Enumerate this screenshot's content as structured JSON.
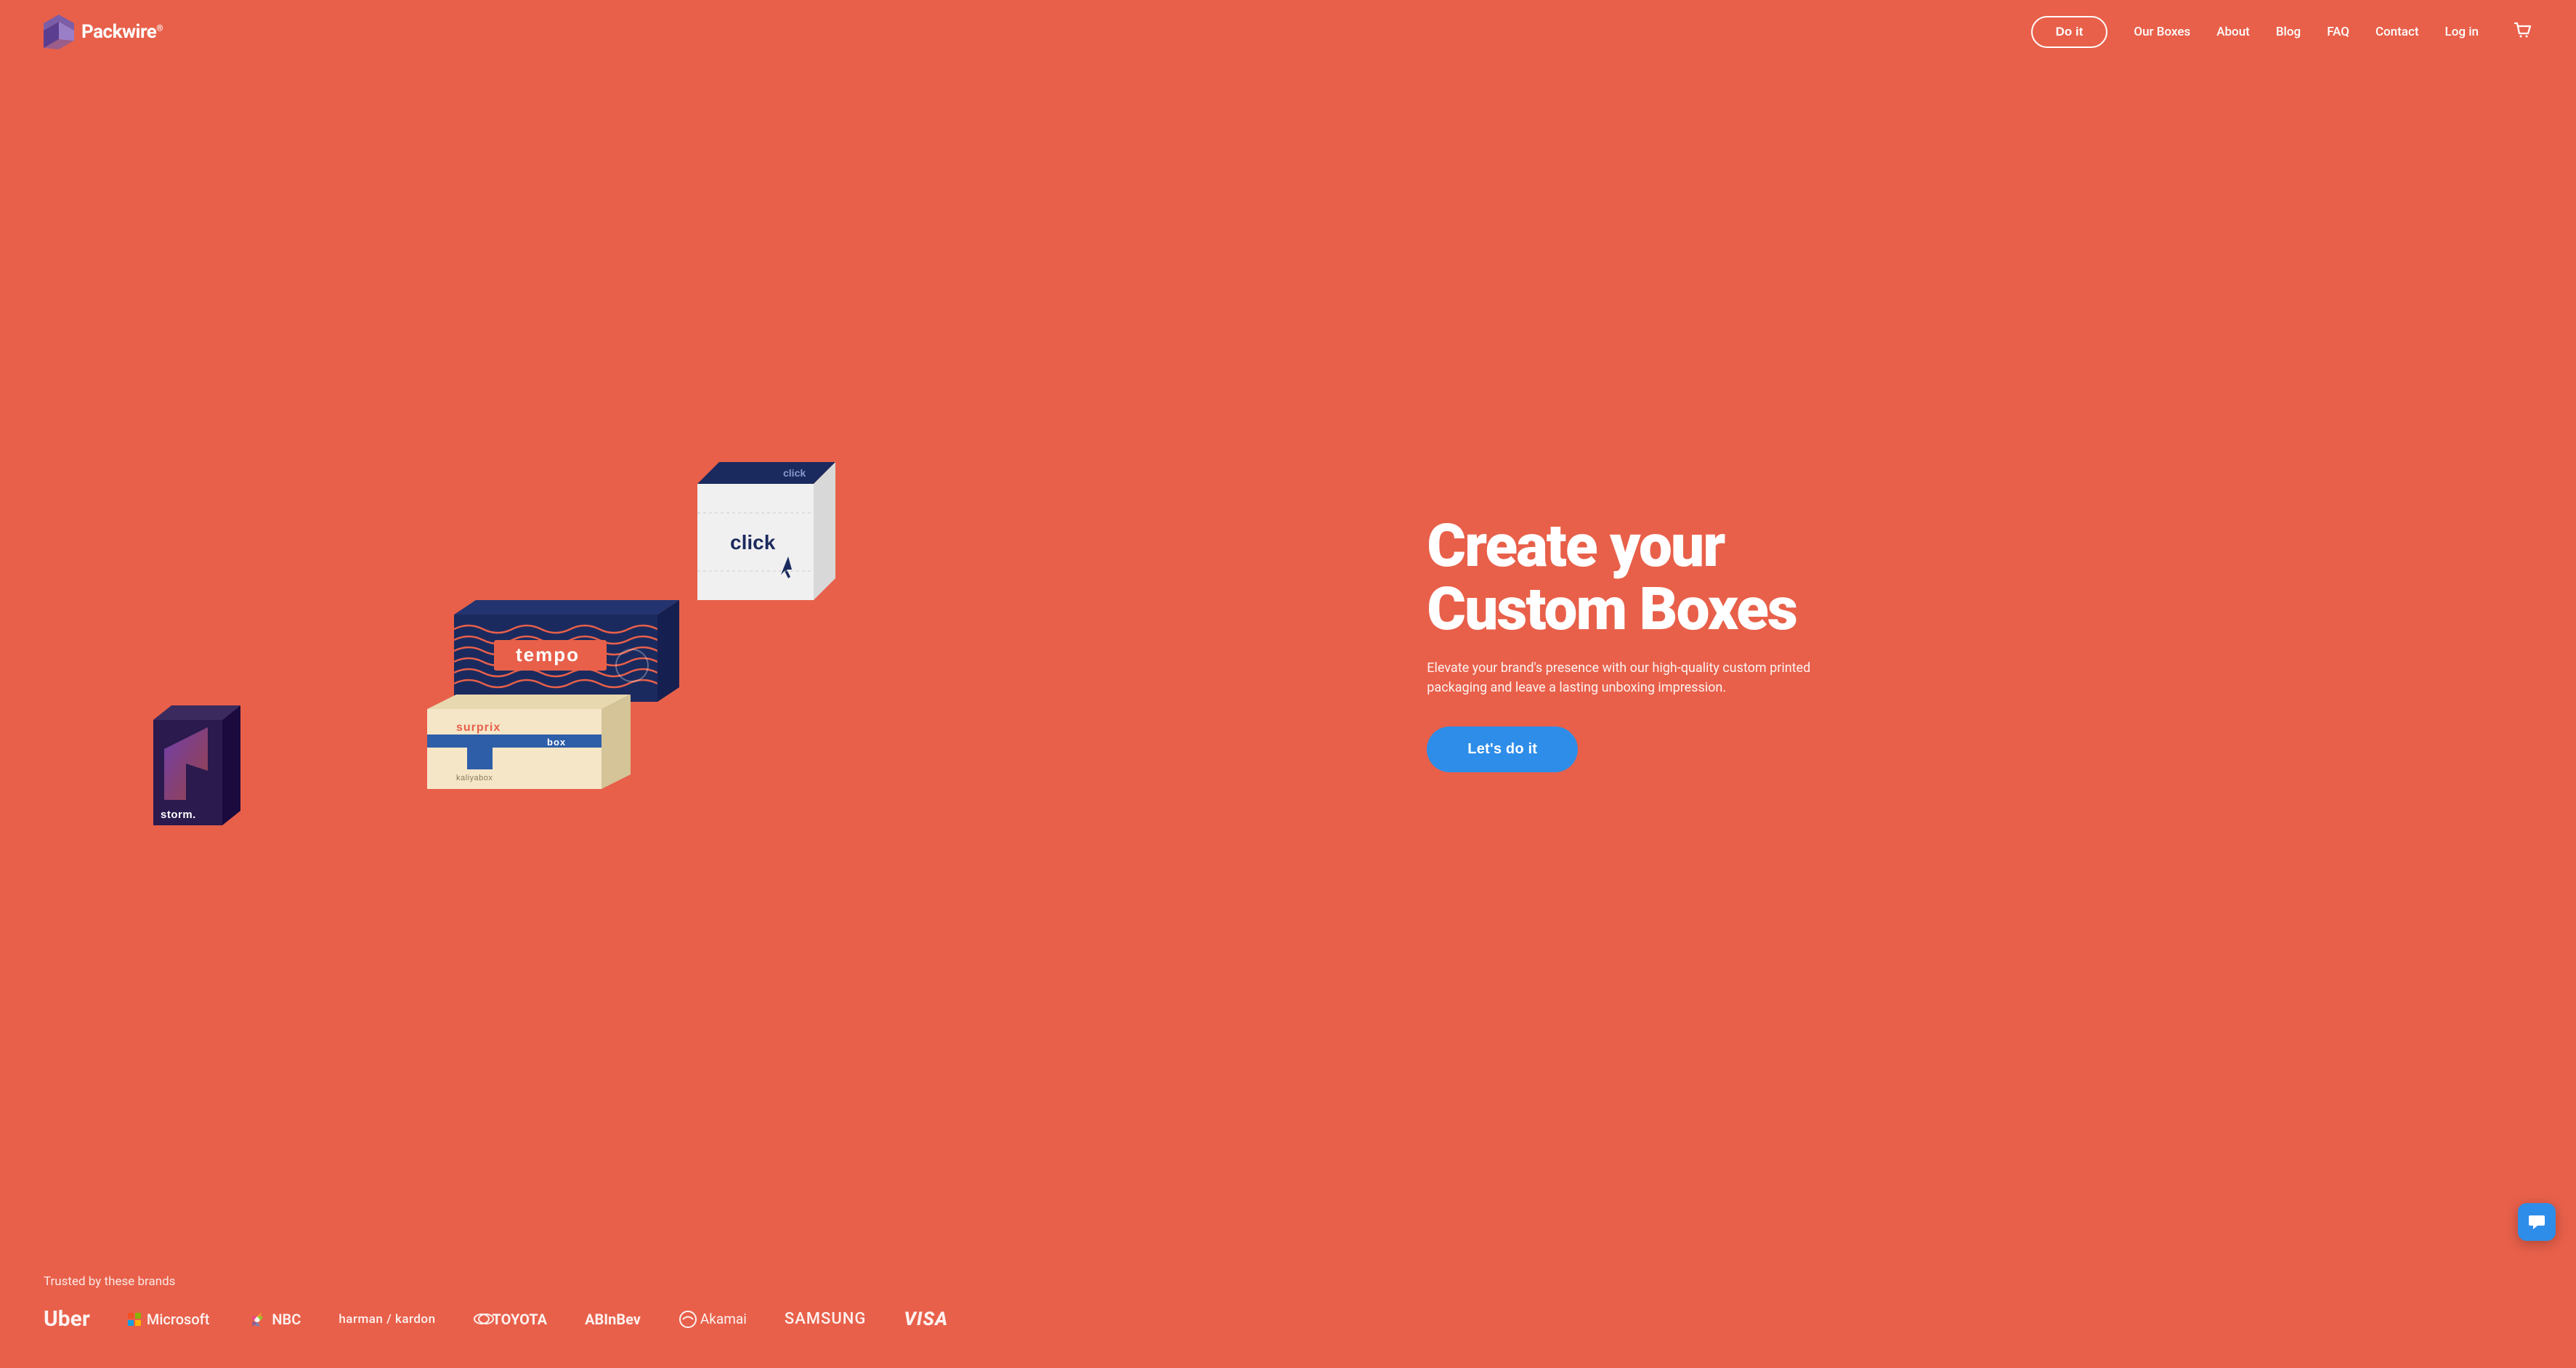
{
  "brand": {
    "name": "Packwire",
    "trademark": "®"
  },
  "nav": {
    "cta_label": "Do it",
    "links": [
      {
        "id": "our-boxes",
        "label": "Our Boxes"
      },
      {
        "id": "about",
        "label": "About"
      },
      {
        "id": "blog",
        "label": "Blog"
      },
      {
        "id": "faq",
        "label": "FAQ"
      },
      {
        "id": "contact",
        "label": "Contact"
      },
      {
        "id": "login",
        "label": "Log in"
      }
    ]
  },
  "hero": {
    "title_line1": "Create your",
    "title_line2": "Custom Boxes",
    "subtitle": "Elevate your brand's presence with our high-quality custom printed packaging and leave a lasting unboxing impression.",
    "cta_label": "Let's do it"
  },
  "brands": {
    "label": "Trusted by these brands",
    "logos": [
      {
        "id": "uber",
        "name": "Uber"
      },
      {
        "id": "microsoft",
        "name": "Microsoft"
      },
      {
        "id": "nbc",
        "name": "NBC"
      },
      {
        "id": "harman",
        "name": "harman / kardon"
      },
      {
        "id": "toyota",
        "name": "TOYOTA"
      },
      {
        "id": "abinbev",
        "name": "ABInBev"
      },
      {
        "id": "akamai",
        "name": "Akamai"
      },
      {
        "id": "samsung",
        "name": "SAMSUNG"
      },
      {
        "id": "visa",
        "name": "VISA"
      }
    ]
  },
  "chat": {
    "icon": "chat-icon"
  }
}
